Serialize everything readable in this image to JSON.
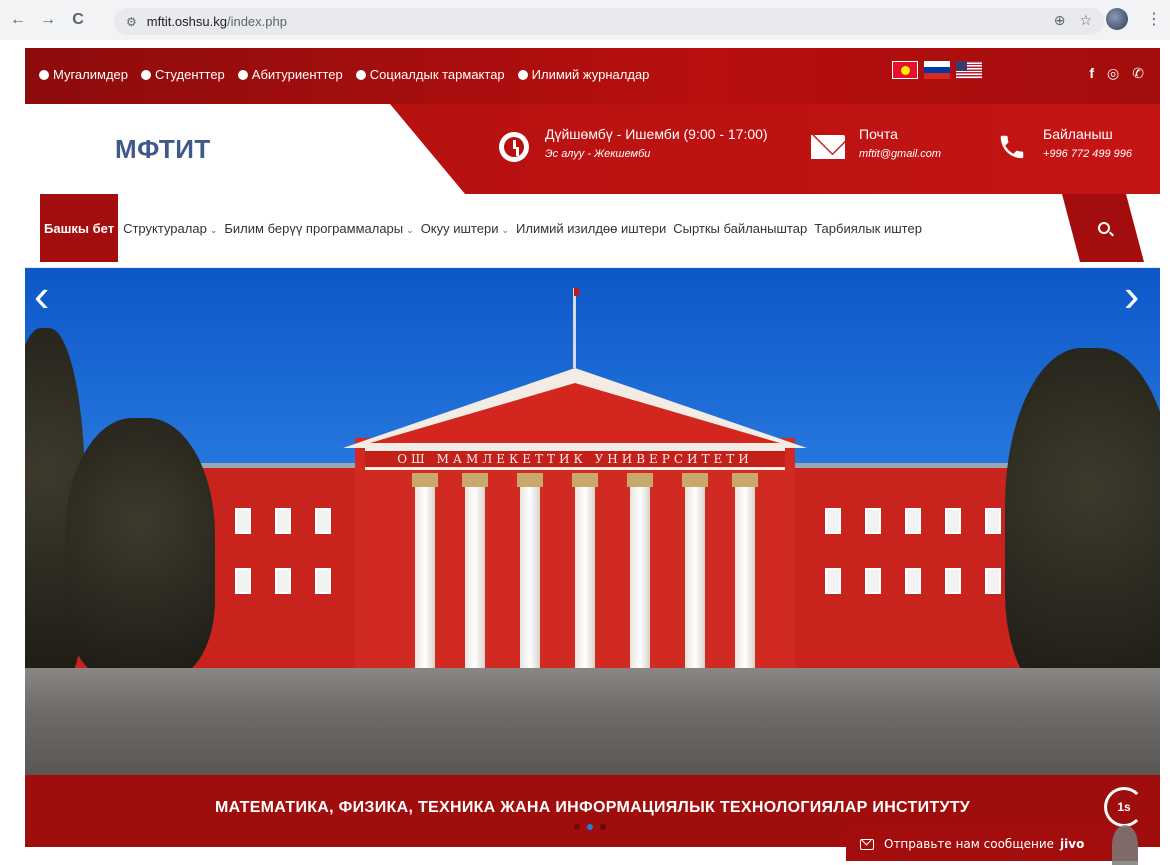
{
  "browser": {
    "url_host": "mftit.oshsu.kg",
    "url_path": "/index.php",
    "back": "←",
    "forward": "→",
    "reload": "C",
    "zoom_icon": "zoom-icon",
    "star_icon": "bookmark-star-icon"
  },
  "topbar": {
    "links": [
      "Мугалимдер",
      "Студенттер",
      "Абитуриенттер",
      "Социалдык тармактар",
      "Илимий журналдар"
    ],
    "flags": [
      "kg-flag-icon",
      "ru-flag-icon",
      "us-flag-icon"
    ],
    "social": {
      "facebook": "f",
      "instagram": "◎",
      "whatsapp": "✆"
    }
  },
  "header": {
    "logo": "МФТИТ",
    "schedule_title": "Дүйшөмбү - Ишемби (9:00 - 17:00)",
    "schedule_sub": "Эс алуу - Жекшемби",
    "mail_title": "Почта",
    "mail_sub": "mftit@gmail.com",
    "phone_title": "Байланыш",
    "phone_sub": "+996 772 499 996"
  },
  "nav": {
    "items": [
      {
        "label": "Башкы бет",
        "dropdown": false
      },
      {
        "label": "Структуралар",
        "dropdown": true
      },
      {
        "label": "Билим берүү программалары",
        "dropdown": true
      },
      {
        "label": "Окуу иштери",
        "dropdown": true
      },
      {
        "label": "Илимий изилдөө иштери",
        "dropdown": false
      },
      {
        "label": "Сырткы байланыштар",
        "dropdown": false
      },
      {
        "label": "Тарбиялык иштер",
        "dropdown": false
      }
    ],
    "chevron": "⌄"
  },
  "slider": {
    "building_sign": "ОШ МАМЛЕКЕТТИК УНИВЕРСИТЕТИ",
    "caption": "МАТЕМАТИКА, ФИЗИКА, ТЕХНИКА ЖАНА ИНФОРМАЦИЯЛЫК ТЕХНОЛОГИЯЛАР ИНСТИТУТУ",
    "prev": "‹",
    "next": "›",
    "timer": "1s",
    "dots": 3,
    "active_dot": 1
  },
  "chat": {
    "label": "Отправьте нам сообщение",
    "brand": "jivo"
  },
  "colors": {
    "brand_red": "#a30d0d",
    "logo_blue": "#3f5a8a"
  }
}
